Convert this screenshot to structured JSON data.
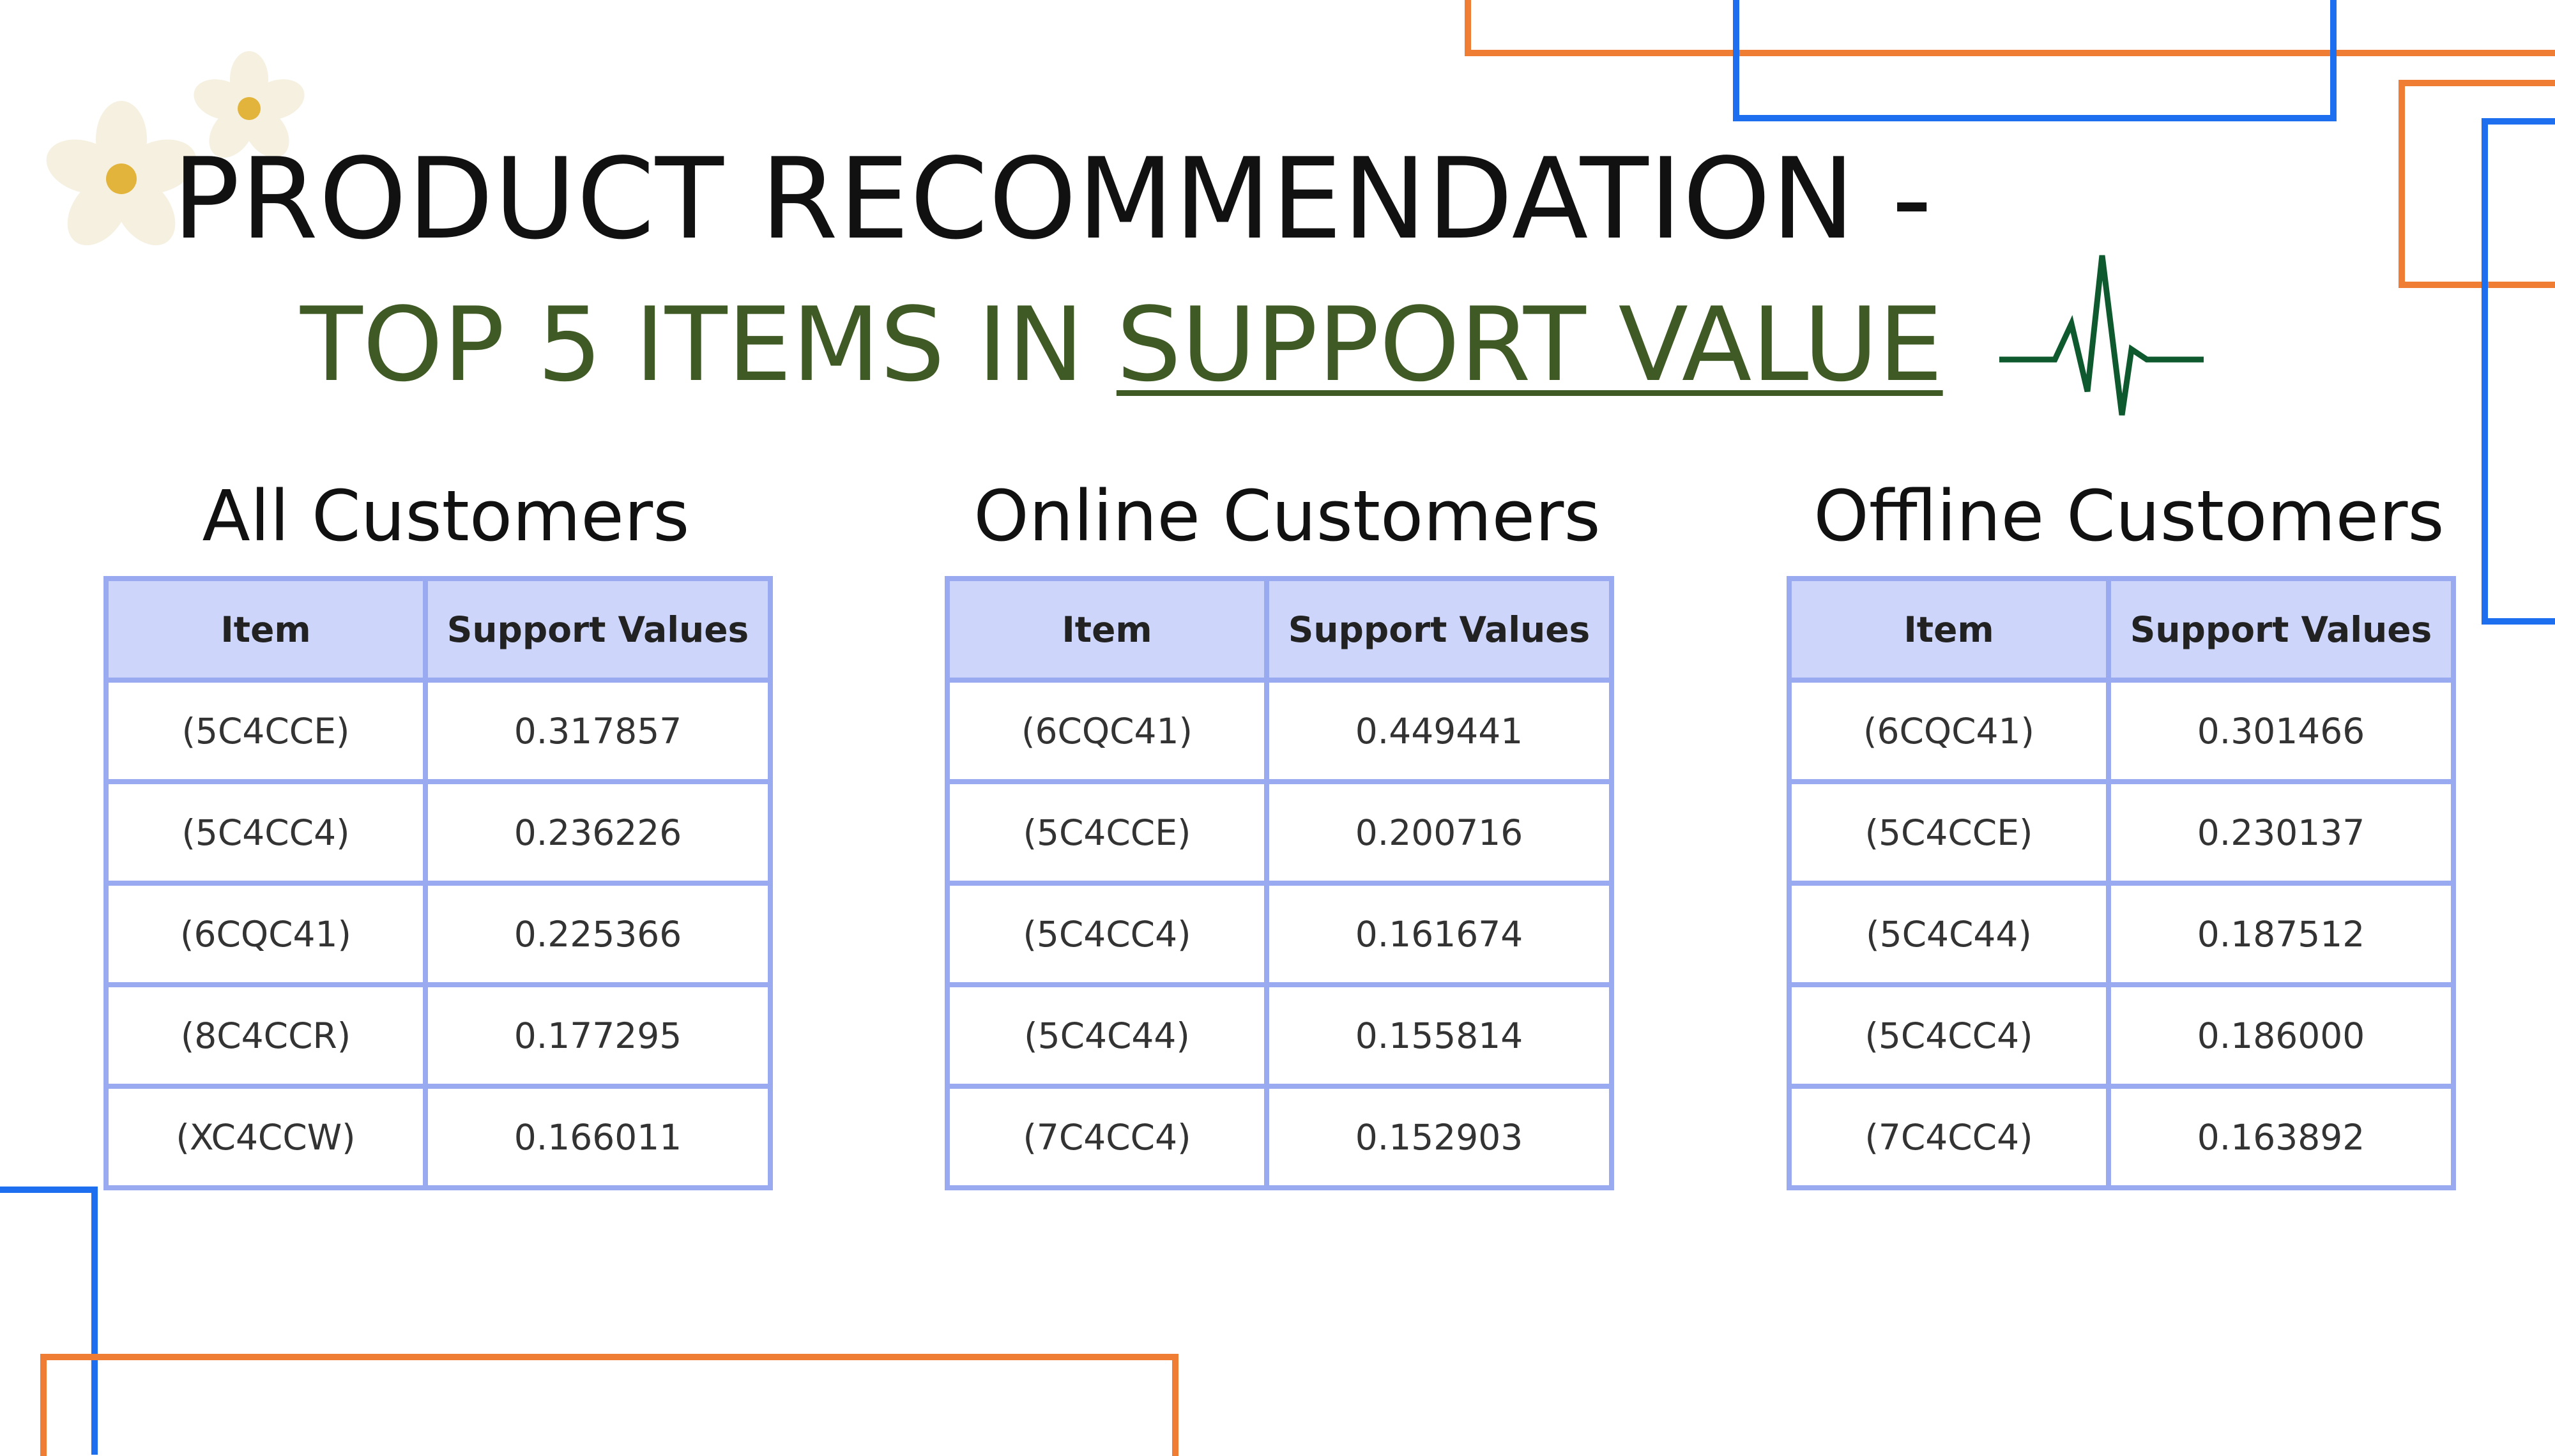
{
  "title_line1": "PRODUCT RECOMMENDATION -",
  "title_line2_prefix": "TOP 5 ITEMS IN ",
  "title_line2_underlined": "SUPPORT VALUE",
  "colors": {
    "accent_orange": "#ef7d34",
    "accent_blue": "#1e6ff0",
    "title_green": "#3f5a24",
    "table_header_bg": "#cdd5fb",
    "table_border": "#9aaaf0",
    "pulse_green": "#0e5a2e"
  },
  "icons": [
    "daisy-flower-icon",
    "heartbeat-pulse-icon"
  ],
  "tables": [
    {
      "title": "All Customers",
      "headers": [
        "Item",
        "Support Values"
      ],
      "rows": [
        [
          "(5C4CCE)",
          "0.317857"
        ],
        [
          "(5C4CC4)",
          "0.236226"
        ],
        [
          "(6CQC41)",
          "0.225366"
        ],
        [
          "(8C4CCR)",
          "0.177295"
        ],
        [
          "(XC4CCW)",
          "0.166011"
        ]
      ]
    },
    {
      "title": "Online Customers",
      "headers": [
        "Item",
        "Support Values"
      ],
      "rows": [
        [
          "(6CQC41)",
          "0.449441"
        ],
        [
          "(5C4CCE)",
          "0.200716"
        ],
        [
          "(5C4CC4)",
          "0.161674"
        ],
        [
          "(5C4C44)",
          "0.155814"
        ],
        [
          "(7C4CC4)",
          "0.152903"
        ]
      ]
    },
    {
      "title": "Offline Customers",
      "headers": [
        "Item",
        "Support Values"
      ],
      "rows": [
        [
          "(6CQC41)",
          "0.301466"
        ],
        [
          "(5C4CCE)",
          "0.230137"
        ],
        [
          "(5C4C44)",
          "0.187512"
        ],
        [
          "(5C4CC4)",
          "0.186000"
        ],
        [
          "(7C4CC4)",
          "0.163892"
        ]
      ]
    }
  ]
}
